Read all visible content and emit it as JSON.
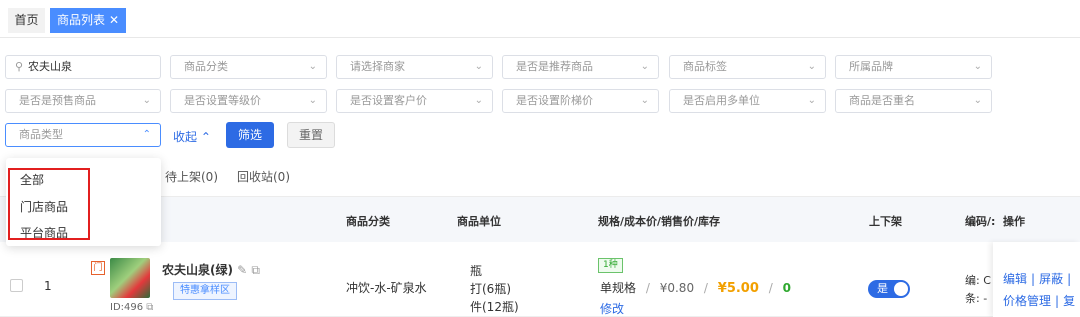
{
  "tabs": {
    "home": "首页",
    "active": "商品列表",
    "active_close": "✕"
  },
  "filters": {
    "row1": [
      "农夫山泉",
      "商品分类",
      "请选择商家",
      "是否是推荐商品",
      "商品标签",
      "所属品牌"
    ],
    "row2": [
      "是否是预售商品",
      "是否设置等级价",
      "是否设置客户价",
      "是否设置阶梯价",
      "是否启用多单位",
      "商品是否重名"
    ],
    "type_select": "商品类型",
    "collapse": "收起",
    "filter_btn": "筛选",
    "reset_btn": "重置"
  },
  "subtabs": [
    "待上架(0)",
    "回收站(0)"
  ],
  "dropdown": {
    "options": [
      "全部",
      "门店商品",
      "平台商品"
    ]
  },
  "table": {
    "headers": [
      "商品分类",
      "商品单位",
      "规格/成本价/销售价/库存",
      "上下架",
      "编码/:",
      "操作"
    ],
    "row": {
      "index": "1",
      "store_tag": "门",
      "name": "农夫山泉(绿)",
      "tag": "特惠拿样区",
      "id": "ID:496",
      "category": "冲饮-水-矿泉水",
      "units": [
        "瓶",
        "打(6瓶)",
        "件(12瓶)"
      ],
      "spec_count": "1种",
      "spec_name": "单规格",
      "cost": "¥0.80",
      "price": "¥5.00",
      "stock": "0",
      "edit": "修改",
      "status": "是",
      "code1": "编: C",
      "code2": "条: -",
      "ops1": [
        "编辑",
        "屏蔽"
      ],
      "ops2": [
        "价格管理",
        "复"
      ]
    }
  },
  "colors": {
    "primary": "#2d6be4",
    "price": "#f2a000",
    "stock": "#2fa82f",
    "highlight": "#e21f1f"
  }
}
